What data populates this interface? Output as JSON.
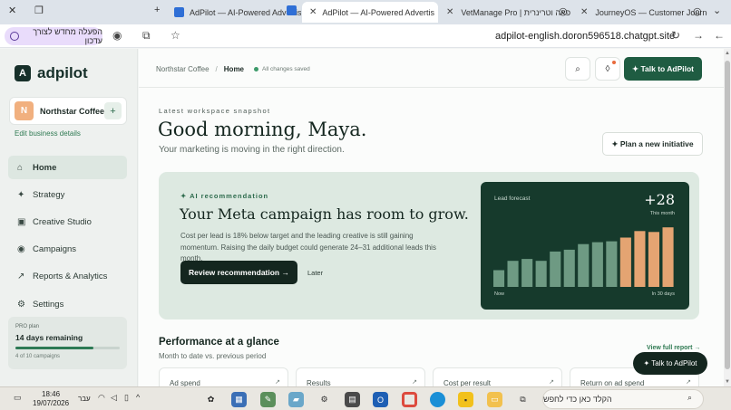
{
  "browser": {
    "tabs": [
      {
        "label": "AdPilot — AI-Powered Advertis",
        "active": false,
        "favicon_color": "#2f6fd6"
      },
      {
        "label": "AdPilot — AI-Powered Advertis",
        "active": true,
        "favicon_color": "#2f6fd6"
      },
      {
        "label": "VetManage Pro | פאה וטרינרית",
        "active": false,
        "favicon_color": "#555555"
      },
      {
        "label": "JourneyOS — Customer Journe",
        "active": false,
        "favicon_color": "#555555"
      }
    ],
    "extension_pill": "הפעלה מחדש לצורך עדכון",
    "url": "adpilot-english.doron596518.chatgpt.site"
  },
  "app": {
    "logo_mark": "A",
    "logo_text": "adpilot",
    "business": {
      "avatar": "N",
      "name": "Northstar Coffee",
      "add": "+"
    },
    "edit_business": "Edit business details",
    "nav": [
      {
        "icon": "⌂",
        "label": "Home",
        "active": true
      },
      {
        "icon": "✦",
        "label": "Strategy",
        "active": false
      },
      {
        "icon": "▣",
        "label": "Creative Studio",
        "active": false
      },
      {
        "icon": "◉",
        "label": "Campaigns",
        "active": false
      },
      {
        "icon": "↗",
        "label": "Reports & Analytics",
        "active": false
      },
      {
        "icon": "⚙",
        "label": "Settings",
        "active": false
      }
    ],
    "plan": {
      "kicker": "PRO plan",
      "remaining": "14 days remaining",
      "progress": 0.75,
      "campaigns": "4 of 10 campaigns"
    }
  },
  "topbar": {
    "breadcrumb_root": "Northstar Coffee",
    "breadcrumb_sep": "/",
    "breadcrumb_current": "Home",
    "saved_status": "All changes saved",
    "search_icon": "⌕",
    "notif_icon": "◊",
    "talk_button": "✦ Talk to AdPilot"
  },
  "hero": {
    "kicker": "Latest workspace snapshot",
    "greeting": "Good morning, Maya.",
    "subtitle": "Your marketing is moving in the right direction.",
    "plan_button": "✦ Plan a new initiative"
  },
  "recommendation": {
    "kicker": "✦ AI recommendation",
    "title": "Your Meta campaign has room to grow.",
    "body": "Cost per lead is 18% below target and the leading creative is still gaining momentum. Raising the daily budget could generate 24–31 additional leads this month.",
    "review_button": "Review recommendation →",
    "later_button": "Later",
    "colors": {
      "card": "#dde9e1",
      "accent": "#2d6b4d"
    }
  },
  "forecast": {
    "title": "Lead forecast",
    "value": "+28",
    "value_sub": "This month",
    "label_start": "Now",
    "label_end": "In 30 days"
  },
  "chart_data": {
    "type": "bar",
    "title": "Lead forecast",
    "categories": [
      "1",
      "2",
      "3",
      "4",
      "5",
      "6",
      "7",
      "8",
      "9",
      "10",
      "11",
      "12",
      "13"
    ],
    "values": [
      18,
      28,
      30,
      28,
      38,
      40,
      46,
      48,
      49,
      53,
      60,
      59,
      64
    ],
    "forecast_from_index": 9,
    "colors": {
      "actual": "#6e9a83",
      "forecast": "#e4a472"
    },
    "ylim": [
      0,
      70
    ]
  },
  "performance": {
    "title": "Performance at a glance",
    "subtitle": "Month to date vs. previous period",
    "view_full": "View full report →",
    "kpis": [
      {
        "label": "Ad spend",
        "arrow": "↗"
      },
      {
        "label": "Results",
        "arrow": "↗"
      },
      {
        "label": "Cost per result",
        "arrow": "↗"
      },
      {
        "label": "Return on ad spend",
        "arrow": "↗"
      }
    ]
  },
  "floating_talk": "✦ Talk to AdPilot",
  "taskbar": {
    "time": "18:46",
    "date": "19/07/2026",
    "lang": "עבר",
    "search_placeholder": "הקלד כאן כדי לחפש"
  }
}
